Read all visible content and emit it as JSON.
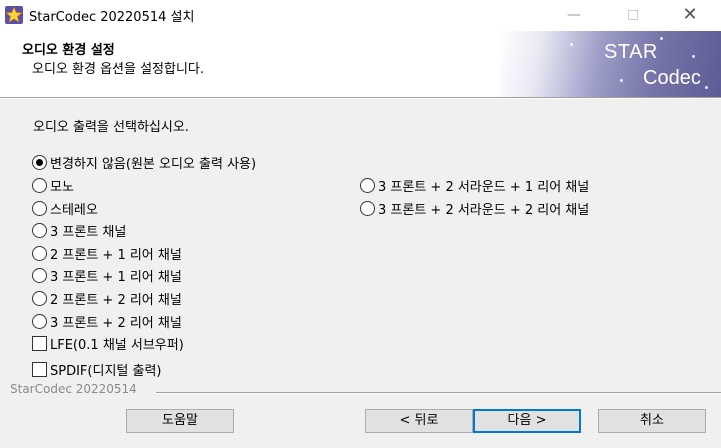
{
  "window": {
    "title": "StarCodec 20220514 설치",
    "icon": "star-icon",
    "controls": {
      "minimize": "—",
      "close": "✕"
    }
  },
  "header": {
    "title": "오디오 환경 설정",
    "subtitle": "오디오 환경 옵션을 설정합니다.",
    "brand_line1": "STAR",
    "brand_line2": "Codec"
  },
  "main": {
    "instruction": "오디오 출력을 선택하십시오.",
    "selected_option": "변경하지 않음(원본 오디오 출력 사용)",
    "radios_left": [
      "변경하지 않음(원본 오디오 출력 사용)",
      "모노",
      "스테레오",
      "3 프론트 채널",
      "2 프론트 + 1 리어 채널",
      "3 프론트 + 1 리어 채널",
      "2 프론트 + 2 리어 채널",
      "3 프론트 + 2 리어 채널"
    ],
    "radios_right": [
      "3 프론트 + 2 서라운드 + 1 리어 채널",
      "3 프론트 + 2 서라운드 + 2 리어 채널"
    ],
    "checkboxes": [
      {
        "label": "LFE(0.1 채널 서브우퍼)",
        "checked": false
      },
      {
        "label": "SPDIF(디지털 출력)",
        "checked": false
      }
    ]
  },
  "footer": {
    "brand": "StarCodec 20220514",
    "buttons": {
      "help": "도움말",
      "back": "< 뒤로",
      "next": "다음 >",
      "cancel": "취소"
    }
  },
  "colors": {
    "background": "#f0f0f0",
    "banner_dark": "#5d5d95",
    "focus_border": "#0078d7"
  }
}
